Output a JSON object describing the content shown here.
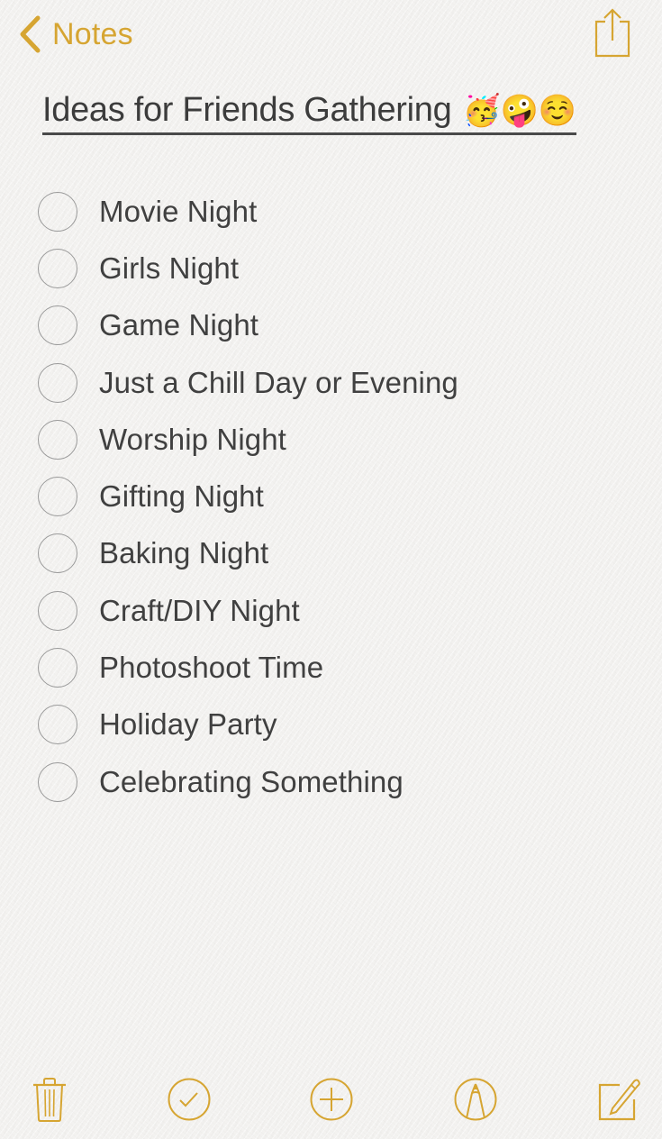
{
  "nav": {
    "back_label": "Notes",
    "back_icon": "chevron-left-icon",
    "share_icon": "share-icon"
  },
  "note": {
    "title": "Ideas for Friends Gathering",
    "title_emoji": "🥳🤪☺️",
    "checklist": [
      {
        "label": "Movie Night",
        "checked": false
      },
      {
        "label": "Girls Night",
        "checked": false
      },
      {
        "label": "Game Night",
        "checked": false
      },
      {
        "label": "Just a Chill Day or Evening",
        "checked": false
      },
      {
        "label": "Worship Night",
        "checked": false
      },
      {
        "label": "Gifting Night",
        "checked": false
      },
      {
        "label": "Baking Night",
        "checked": false
      },
      {
        "label": "Craft/DIY Night",
        "checked": false
      },
      {
        "label": "Photoshoot Time",
        "checked": false
      },
      {
        "label": "Holiday Party",
        "checked": false
      },
      {
        "label": "Celebrating Something",
        "checked": false
      }
    ]
  },
  "toolbar": {
    "items": [
      {
        "name": "delete",
        "icon": "trash-icon"
      },
      {
        "name": "checklist",
        "icon": "checkmark-circle-icon"
      },
      {
        "name": "add",
        "icon": "plus-circle-icon"
      },
      {
        "name": "markup",
        "icon": "pen-tip-circle-icon"
      },
      {
        "name": "compose",
        "icon": "compose-icon"
      }
    ]
  },
  "colors": {
    "accent": "#d6a532",
    "text": "#404040",
    "checkbox_border": "#9a9a9a",
    "background": "#f3f2f0"
  }
}
